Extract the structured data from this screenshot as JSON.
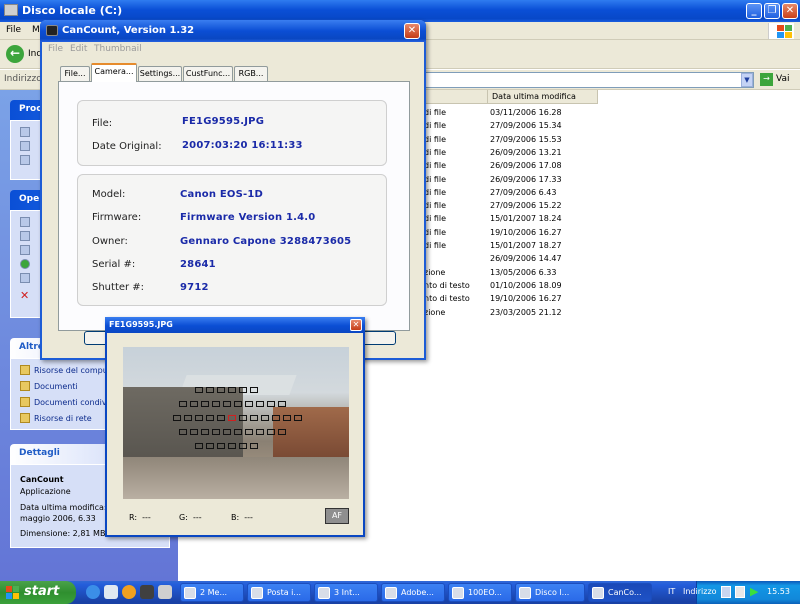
{
  "explorer": {
    "title": "Disco locale (C:)",
    "menu": [
      "File",
      "M"
    ],
    "back_label": "Ind",
    "address_label": "Indirizzo",
    "go_label": "Vai",
    "task_pane": {
      "processes_header": "Proce",
      "operations_header": "Oper",
      "other_header": "Altre",
      "other_items": [
        "Risorse del compu",
        "Documenti",
        "Documenti condivi",
        "Risorse di rete"
      ],
      "details_header": "Dettagli",
      "details_name": "CanCount",
      "details_type": "Applicazione",
      "details_modified": "Data ultima modifica: s",
      "details_modified2": "maggio 2006, 6.33",
      "details_size": "Dimensione: 2,81 MB"
    },
    "list_header_date": "Data ultima modifica",
    "rows": [
      {
        "type": "di file",
        "date": "03/11/2006 16.28"
      },
      {
        "type": "di file",
        "date": "27/09/2006 15.34"
      },
      {
        "type": "di file",
        "date": "27/09/2006 15.53"
      },
      {
        "type": "di file",
        "date": "26/09/2006 13.21"
      },
      {
        "type": "di file",
        "date": "26/09/2006 17.08"
      },
      {
        "type": "di file",
        "date": "26/09/2006 17.33"
      },
      {
        "type": "di file",
        "date": "27/09/2006 6.43"
      },
      {
        "type": "di file",
        "date": "27/09/2006 15.22"
      },
      {
        "type": "di file",
        "date": "15/01/2007 18.24"
      },
      {
        "type": "di file",
        "date": "19/10/2006 16.27"
      },
      {
        "type": "di file",
        "date": "15/01/2007 18.27"
      },
      {
        "type": "",
        "date": "26/09/2006 14.47"
      },
      {
        "type": "zione",
        "date": "13/05/2006 6.33"
      },
      {
        "type": "nto di testo",
        "date": "01/10/2006 18.09"
      },
      {
        "type": "nto di testo",
        "date": "19/10/2006 16.27"
      },
      {
        "type": "zione",
        "date": "23/03/2005 21.12"
      }
    ]
  },
  "cancount": {
    "title": "CanCount, Version 1.32",
    "menu": [
      "File",
      "Edit",
      "Thumbnail"
    ],
    "tabs": [
      "File...",
      "Camera...",
      "Settings...",
      "CustFunc...",
      "RGB..."
    ],
    "active_tab": "Camera...",
    "file_label": "File:",
    "file_value": "FE1G9595.JPG",
    "date_label": "Date Original:",
    "date_value": "2007:03:20 16:11:33",
    "model_label": "Model:",
    "model_value": "Canon EOS-1D",
    "firmware_label": "Firmware:",
    "firmware_value": "Firmware Version 1.4.0",
    "owner_label": "Owner:",
    "owner_value": "Gennaro Capone 3288473605",
    "serial_label": "Serial #:",
    "serial_value": "28641",
    "shutter_label": "Shutter #:",
    "shutter_value": "9712"
  },
  "preview": {
    "title": "FE1G9595.JPG",
    "r_label": "R:",
    "r_value": "---",
    "g_label": "G:",
    "g_value": "---",
    "b_label": "B:",
    "b_value": "---",
    "af_label": "AF"
  },
  "taskbar": {
    "start_label": "start",
    "buttons": [
      "2 Me...",
      "Posta i...",
      "3 Int...",
      "Adobe...",
      "100EO...",
      "Disco l...",
      "CanCo..."
    ],
    "active_button": "CanCo...",
    "lang": "IT",
    "address_label": "Indirizzo",
    "clock": "15.53"
  },
  "colors": {
    "xp_blue": "#0a4fd6",
    "value_blue": "#1a2aa8",
    "tab_accent": "#e68b2c",
    "start_green": "#3aa03a"
  }
}
